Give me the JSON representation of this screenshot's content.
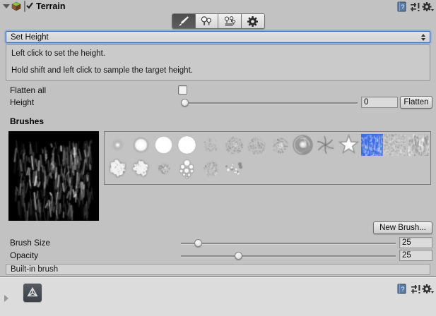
{
  "window": {
    "component_title": "Terrain",
    "enabled": true
  },
  "colors": {
    "inspector_bg": "#c2c2c2",
    "footer_bg": "#dcdcdc",
    "selection_blue": "#3a6be4",
    "selected_tool_bg": "#555555"
  },
  "header": {
    "title": "Terrain",
    "icons": [
      "terrain-component-icon",
      "help-book-icon",
      "presets-icon",
      "settings-gear-icon"
    ]
  },
  "toolbar": {
    "tools": [
      {
        "name": "paint-terrain-brush",
        "icon": "paintbrush-icon",
        "selected": true
      },
      {
        "name": "paint-trees",
        "icon": "trees-icon",
        "selected": false
      },
      {
        "name": "paint-details",
        "icon": "details-grass-icon",
        "selected": false
      },
      {
        "name": "terrain-settings",
        "icon": "gear-icon",
        "selected": false
      }
    ]
  },
  "tool_dropdown": {
    "value": "Set Height"
  },
  "help_box": {
    "lines": [
      "Left click to set the height.",
      "Hold shift and left click to sample the target height."
    ]
  },
  "fields": {
    "flatten_all": {
      "label": "Flatten all",
      "checked": false
    },
    "height": {
      "label": "Height",
      "value": "0",
      "button": "Flatten",
      "slider_fraction": 0
    },
    "brush_size": {
      "label": "Brush Size",
      "value": "25",
      "slider_fraction": 0.066
    },
    "opacity": {
      "label": "Opacity",
      "value": "25",
      "slider_fraction": 0.26
    }
  },
  "brushes": {
    "section_label": "Brushes",
    "new_brush_button": "New Brush...",
    "builtin_label": "Built-in brush",
    "selected_index": 11,
    "preview": "large-dark-noise-brush-preview",
    "items": [
      {
        "name": "brush-soft-circle-small",
        "type": "soft1",
        "row": 0
      },
      {
        "name": "brush-soft-circle",
        "type": "soft2",
        "row": 0
      },
      {
        "name": "brush-circle-soft-edge",
        "type": "soft3",
        "row": 0
      },
      {
        "name": "brush-hard-circle",
        "type": "hard",
        "row": 0
      },
      {
        "name": "brush-sparse-noise",
        "type": "noise1",
        "row": 0
      },
      {
        "name": "brush-dense-speckle",
        "type": "noise2",
        "row": 0
      },
      {
        "name": "brush-round-speckle",
        "type": "noise3",
        "row": 0
      },
      {
        "name": "brush-splat-scatter",
        "type": "splat",
        "row": 0
      },
      {
        "name": "brush-swirl-cloud",
        "type": "swirl",
        "row": 0
      },
      {
        "name": "brush-asterisk-splat",
        "type": "aster",
        "row": 0
      },
      {
        "name": "brush-star-outline",
        "type": "star",
        "row": 0
      },
      {
        "name": "brush-noise-texture-selected",
        "type": "tex1",
        "row": 0,
        "selected": true
      },
      {
        "name": "brush-rough-texture",
        "type": "tex2",
        "row": 0
      },
      {
        "name": "brush-streak-texture",
        "type": "tex3",
        "row": 0
      },
      {
        "name": "brush-rough-blob",
        "type": "blob1",
        "row": 1
      },
      {
        "name": "brush-rough-blob-2",
        "type": "blob2",
        "row": 1
      },
      {
        "name": "brush-small-scatter",
        "type": "mini",
        "row": 1
      },
      {
        "name": "brush-bubble-cluster",
        "type": "bubbles",
        "row": 1
      },
      {
        "name": "brush-speck-cluster",
        "type": "scatter",
        "row": 1
      },
      {
        "name": "brush-sparse-dots",
        "type": "dots",
        "row": 1
      }
    ]
  },
  "footer": {
    "icons": [
      "unity-logo-icon",
      "help-book-icon",
      "presets-icon",
      "settings-gear-icon"
    ]
  }
}
